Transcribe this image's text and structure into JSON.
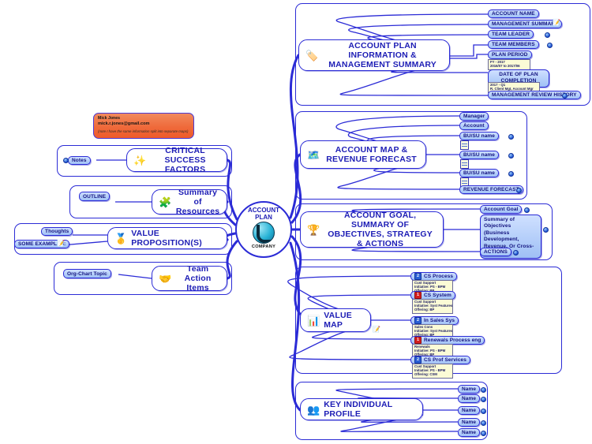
{
  "center": {
    "title_line1": "ACCOUNT",
    "title_line2": "PLAN",
    "company": "COMPANY",
    "logo_icon": "globe-logo-icon"
  },
  "callout": {
    "name": "Mick Jones",
    "email": "mick.r.jones@gmail.com",
    "note": "(note I have the same information split into separate maps)"
  },
  "colors": {
    "line": "#2b2bd6",
    "node_text": "#1d1db5",
    "leaf_fill_top": "#cfe0ff",
    "leaf_fill_bottom": "#9fc0f5",
    "callout_bg": "#ef6a3b",
    "note_bg": "#fbfbd6",
    "priority_red": "#d41f1f",
    "priority_blue": "#2a5fd4"
  },
  "right_branches": [
    {
      "id": "account-plan-information",
      "title": "ACCOUNT PLAN INFORMATION & MANAGEMENT SUMMARY",
      "icon": "blue-tag-icon",
      "children": [
        {
          "label": "ACCOUNT NAME",
          "marker": false
        },
        {
          "label": "MANAGEMENT SUMMARY",
          "marker": true,
          "extra_icon": "note-icon"
        },
        {
          "label": "TEAM LEADER",
          "marker": true
        },
        {
          "label": "TEAM MEMBERS",
          "marker": true
        },
        {
          "label": "PLAN PERIOD",
          "marker": false,
          "note": [
            "FY - 2017",
            "2016/07 to 2017/06"
          ]
        },
        {
          "label": "DATE OF PLAN COMPLETION",
          "marker": false,
          "two_line": true,
          "note": [
            "2017 - Q1",
            "R. Client Mgt, Account Mgr"
          ]
        },
        {
          "label": "MANAGEMENT REVIEW HISTORY",
          "marker": true
        }
      ]
    },
    {
      "id": "account-map-revenue-forecast",
      "title": "ACCOUNT MAP & REVENUE FORECAST",
      "icon": "org-chart-icon",
      "children": [
        {
          "label": "Manager",
          "marker": false
        },
        {
          "label": "Account",
          "marker": false
        },
        {
          "label": "BU/SU name",
          "marker": true,
          "table_icon": true
        },
        {
          "label": "BU/SU name",
          "marker": true,
          "table_icon": true
        },
        {
          "label": "BU/SU name",
          "marker": true,
          "table_icon": true
        },
        {
          "label": "REVENUE FORECAST",
          "marker": true
        }
      ]
    },
    {
      "id": "account-goal-objectives",
      "title": "ACCOUNT GOAL,  SUMMARY OF OBJECTIVES, STRATEGY & ACTIONS",
      "icon": "trophy-icon",
      "children": [
        {
          "label": "Account Goal",
          "marker": true
        },
        {
          "label": "Summary of Objectives (Business Development, Revenue, Or Cross-Account)",
          "marker": true,
          "big": true
        },
        {
          "label": "ACTIONS",
          "marker": true
        }
      ]
    },
    {
      "id": "value-map",
      "title": "VALUE MAP",
      "icon": "chart-icon",
      "children": [
        {
          "label": "CS Process",
          "priority": "2",
          "priority_color": "blue",
          "note": [
            "Cust Support",
            "Initiative: PS - BPM",
            "Offering: BP"
          ]
        },
        {
          "label": "CS System",
          "priority": "1",
          "priority_color": "red",
          "note": [
            "Cust Support",
            "Initiative: Syst Features",
            "Offering: BP"
          ]
        },
        {
          "label": "In Sales Sys",
          "priority": "2",
          "priority_color": "blue",
          "note": [
            "Sales Cons",
            "Initiative: Syst Features",
            "Offering: BP"
          ]
        },
        {
          "label": "Renewals Process eng",
          "priority": "1",
          "priority_color": "red",
          "note": [
            "Renewals",
            "Initiative: PS - BPM",
            "Offering: BP"
          ]
        },
        {
          "label": "CS Prof Services",
          "priority": "2",
          "priority_color": "blue",
          "note": [
            "Cust Support",
            "Initiative: PS - BPM",
            "Offering: CSM"
          ]
        }
      ]
    },
    {
      "id": "key-individual-profile",
      "title": "KEY INDIVIDUAL PROFILE",
      "icon": "people-icon",
      "children": [
        {
          "label": "Name",
          "marker": true
        },
        {
          "label": "Name",
          "marker": true
        },
        {
          "label": "Name",
          "marker": true
        },
        {
          "label": "Name",
          "marker": true
        },
        {
          "label": "Name",
          "marker": true
        }
      ]
    }
  ],
  "left_branches": [
    {
      "id": "critical-success-factors",
      "title": "CRITICAL SUCCESS FACTORS",
      "icon": "sparkler-icon",
      "children": [
        {
          "label": "Notes",
          "marker": true
        }
      ]
    },
    {
      "id": "summary-of-resources",
      "title": "Summary of Resources",
      "icon": "puzzle-icon",
      "children": [
        {
          "label": "OUTLINE",
          "marker": false
        }
      ]
    },
    {
      "id": "value-propositions",
      "title": "VALUE PROPOSITION(S)",
      "icon": "gold-icon",
      "children": [
        {
          "label": "Thoughts",
          "marker": false
        },
        {
          "label": "SOME EXAMPLES:",
          "marker": false
        }
      ]
    },
    {
      "id": "team-action-items",
      "title": "Team Action Items",
      "icon": "hand-icon",
      "children": [
        {
          "label": "Org-Chart Topic",
          "marker": false
        }
      ]
    }
  ]
}
